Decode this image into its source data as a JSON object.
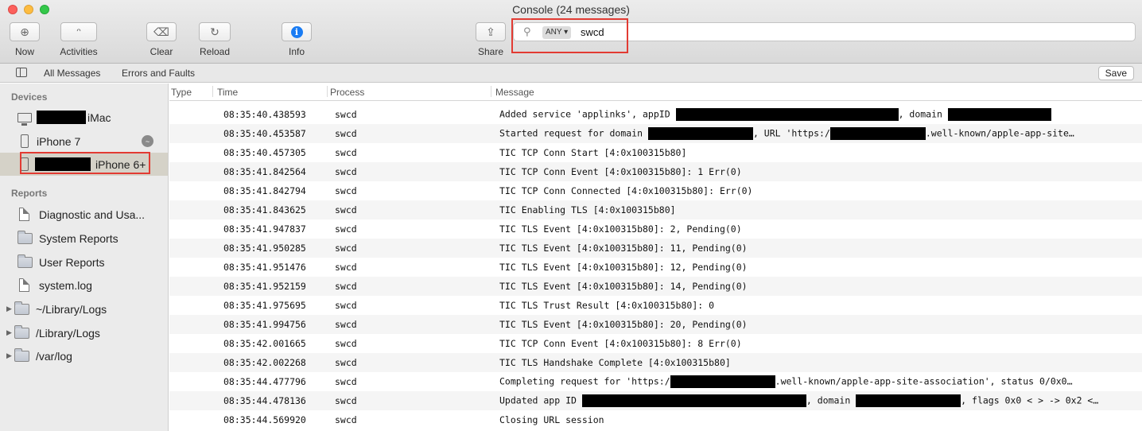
{
  "window": {
    "title": "Console (24 messages)"
  },
  "toolbar": {
    "now_label": "Now",
    "activities_label": "Activities",
    "clear_label": "Clear",
    "reload_label": "Reload",
    "info_label": "Info",
    "share_label": "Share"
  },
  "search": {
    "token": "ANY ▾",
    "query": "swcd"
  },
  "filterbar": {
    "all_messages": "All Messages",
    "errors_faults": "Errors and Faults",
    "save": "Save"
  },
  "sidebar": {
    "devices_heading": "Devices",
    "devices": [
      {
        "label": "iMac"
      },
      {
        "label": "iPhone 7"
      },
      {
        "label": "iPhone 6+"
      }
    ],
    "reports_heading": "Reports",
    "reports": [
      {
        "label": "Diagnostic and Usa..."
      },
      {
        "label": "System Reports"
      },
      {
        "label": "User Reports"
      },
      {
        "label": "system.log"
      },
      {
        "label": "~/Library/Logs"
      },
      {
        "label": "/Library/Logs"
      },
      {
        "label": "/var/log"
      }
    ]
  },
  "table": {
    "columns": [
      "Type",
      "Time",
      "Process",
      "Message"
    ],
    "rows": [
      {
        "time": "08:35:40.438593",
        "process": "swcd",
        "msg_a": "Added service 'applinks', appID ",
        "msg_b": ", domain ",
        "msg_c": ""
      },
      {
        "time": "08:35:40.453587",
        "process": "swcd",
        "msg_a": "Started request for domain ",
        "msg_b": ", URL 'https:/",
        "msg_c": ".well-known/apple-app-site…"
      },
      {
        "time": "08:35:40.457305",
        "process": "swcd",
        "msg_a": "TIC TCP Conn Start [4:0x100315b80]",
        "msg_b": "",
        "msg_c": ""
      },
      {
        "time": "08:35:41.842564",
        "process": "swcd",
        "msg_a": "TIC TCP Conn Event [4:0x100315b80]: 1 Err(0)",
        "msg_b": "",
        "msg_c": ""
      },
      {
        "time": "08:35:41.842794",
        "process": "swcd",
        "msg_a": "TIC TCP Conn Connected [4:0x100315b80]: Err(0)",
        "msg_b": "",
        "msg_c": ""
      },
      {
        "time": "08:35:41.843625",
        "process": "swcd",
        "msg_a": "TIC Enabling TLS [4:0x100315b80]",
        "msg_b": "",
        "msg_c": ""
      },
      {
        "time": "08:35:41.947837",
        "process": "swcd",
        "msg_a": "TIC TLS Event [4:0x100315b80]: 2, Pending(0)",
        "msg_b": "",
        "msg_c": ""
      },
      {
        "time": "08:35:41.950285",
        "process": "swcd",
        "msg_a": "TIC TLS Event [4:0x100315b80]: 11, Pending(0)",
        "msg_b": "",
        "msg_c": ""
      },
      {
        "time": "08:35:41.951476",
        "process": "swcd",
        "msg_a": "TIC TLS Event [4:0x100315b80]: 12, Pending(0)",
        "msg_b": "",
        "msg_c": ""
      },
      {
        "time": "08:35:41.952159",
        "process": "swcd",
        "msg_a": "TIC TLS Event [4:0x100315b80]: 14, Pending(0)",
        "msg_b": "",
        "msg_c": ""
      },
      {
        "time": "08:35:41.975695",
        "process": "swcd",
        "msg_a": "TIC TLS Trust Result [4:0x100315b80]: 0",
        "msg_b": "",
        "msg_c": ""
      },
      {
        "time": "08:35:41.994756",
        "process": "swcd",
        "msg_a": "TIC TLS Event [4:0x100315b80]: 20, Pending(0)",
        "msg_b": "",
        "msg_c": ""
      },
      {
        "time": "08:35:42.001665",
        "process": "swcd",
        "msg_a": "TIC TCP Conn Event [4:0x100315b80]: 8 Err(0)",
        "msg_b": "",
        "msg_c": ""
      },
      {
        "time": "08:35:42.002268",
        "process": "swcd",
        "msg_a": "TIC TLS Handshake Complete [4:0x100315b80]",
        "msg_b": "",
        "msg_c": ""
      },
      {
        "time": "08:35:44.477796",
        "process": "swcd",
        "msg_a": "Completing request for 'https:/",
        "msg_b": ".well-known/apple-app-site-association', status 0/0x0…",
        "msg_c": ""
      },
      {
        "time": "08:35:44.478136",
        "process": "swcd",
        "msg_a": "Updated app ID ",
        "msg_b": ", domain ",
        "msg_c": ", flags 0x0 < > -> 0x2 <…"
      },
      {
        "time": "08:35:44.569920",
        "process": "swcd",
        "msg_a": "Closing URL session",
        "msg_b": "",
        "msg_c": ""
      }
    ]
  }
}
